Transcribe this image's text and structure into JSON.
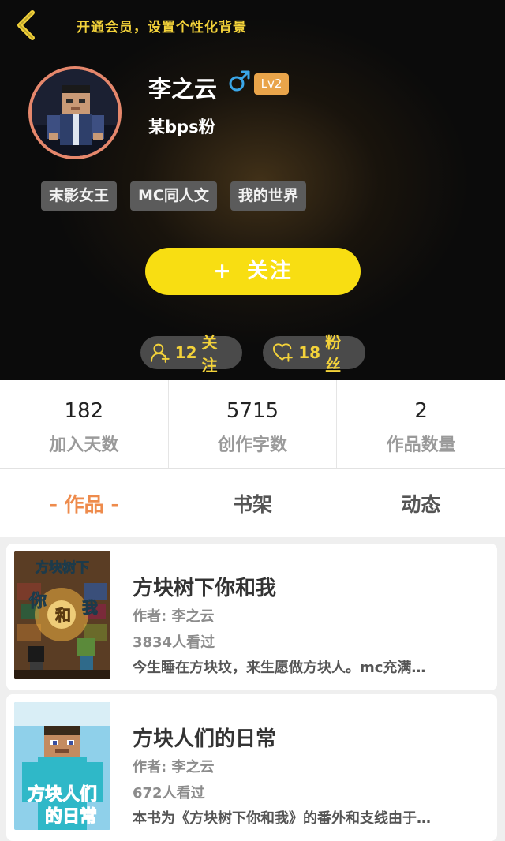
{
  "header": {
    "title": "开通会员，设置个性化背景",
    "back_icon": "chevron-left-icon"
  },
  "profile": {
    "name": "李之云",
    "gender_icon": "male-icon",
    "level": "Lv2",
    "signature": "某bps粉",
    "tags": [
      "末影女王",
      "MC同人文",
      "我的世界"
    ],
    "follow_button": {
      "plus": "+",
      "label": "关注"
    },
    "following": {
      "icon": "add-user-icon",
      "count": "12",
      "label": "关注"
    },
    "fans": {
      "icon": "heart-plus-icon",
      "count": "18",
      "label": "粉丝"
    }
  },
  "stats": [
    {
      "value": "182",
      "label": "加入天数"
    },
    {
      "value": "5715",
      "label": "创作字数"
    },
    {
      "value": "2",
      "label": "作品数量"
    }
  ],
  "tabs": [
    {
      "label": "- 作品 -",
      "active": true
    },
    {
      "label": "书架",
      "active": false
    },
    {
      "label": "动态",
      "active": false
    }
  ],
  "works": [
    {
      "title": "方块树下你和我",
      "author": "作者: 李之云",
      "views": "3834人看过",
      "description": "今生睡在方块坟，来生愿做方块人。mc充满…",
      "cover_text": [
        "方块树下",
        "你",
        "和",
        "我"
      ]
    },
    {
      "title": "方块人们的日常",
      "author": "作者: 李之云",
      "views": "672人看过",
      "description": "本书为《方块树下你和我》的番外和支线由于…",
      "cover_text": [
        "方块人们",
        "的日常"
      ]
    }
  ],
  "colors": {
    "accent_yellow": "#f8de12",
    "title_yellow": "#f3d23a",
    "active_tab": "#ee8b4c",
    "level_badge": "#e9a44a",
    "avatar_ring": "#e5876c"
  }
}
